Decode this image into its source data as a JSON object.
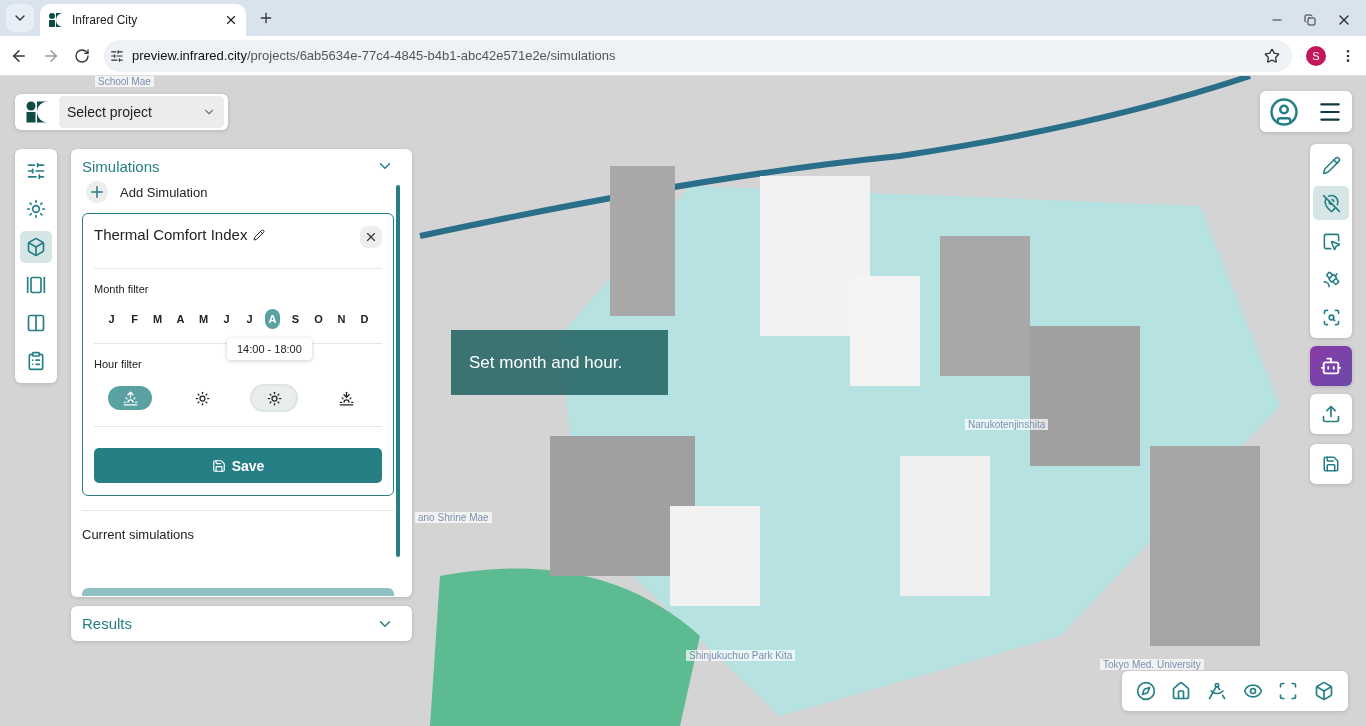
{
  "browser": {
    "tab_title": "Infrared City",
    "url_host": "preview.infrared.city",
    "url_path": "/projects/6ab5634e-77c4-4845-b4b1-abc42e571e2e/simulations",
    "profile_letter": "S"
  },
  "project_select": {
    "placeholder": "Select project"
  },
  "sidebar_items": [
    {
      "selected": false
    },
    {
      "selected": false
    },
    {
      "selected": true
    },
    {
      "selected": false
    },
    {
      "selected": false
    },
    {
      "selected": false
    }
  ],
  "simulations": {
    "title": "Simulations",
    "add_label": "Add Simulation",
    "card": {
      "title": "Thermal Comfort Index",
      "month_filter_label": "Month filter",
      "months": [
        {
          "label": "J",
          "selected": false
        },
        {
          "label": "F",
          "selected": false
        },
        {
          "label": "M",
          "selected": false
        },
        {
          "label": "A",
          "selected": false
        },
        {
          "label": "M",
          "selected": false
        },
        {
          "label": "J",
          "selected": false
        },
        {
          "label": "J",
          "selected": false
        },
        {
          "label": "A",
          "selected": true
        },
        {
          "label": "S",
          "selected": false
        },
        {
          "label": "O",
          "selected": false
        },
        {
          "label": "N",
          "selected": false
        },
        {
          "label": "D",
          "selected": false
        }
      ],
      "hour_filter_label": "Hour filter",
      "hours": [
        {
          "kind": "sunrise",
          "selected": true,
          "hovered": false
        },
        {
          "kind": "sun",
          "selected": false,
          "hovered": false
        },
        {
          "kind": "sun",
          "selected": false,
          "hovered": true
        },
        {
          "kind": "sunset",
          "selected": false,
          "hovered": false
        }
      ],
      "hour_tooltip": "14:00 - 18:00",
      "save_label": "Save"
    },
    "current_label": "Current simulations"
  },
  "results": {
    "title": "Results"
  },
  "hint": "Set month and hour.",
  "right_tools": [
    {
      "selected": false
    },
    {
      "selected": true
    },
    {
      "selected": false
    },
    {
      "selected": false
    },
    {
      "selected": false
    }
  ],
  "map_labels": [
    {
      "text": "School Mae"
    },
    {
      "text": "Narukotenjinshita"
    },
    {
      "text": "ano Shrine Mae"
    },
    {
      "text": "Shinjukuchuo Park Kita"
    },
    {
      "text": "Tokyo Med. University"
    }
  ]
}
